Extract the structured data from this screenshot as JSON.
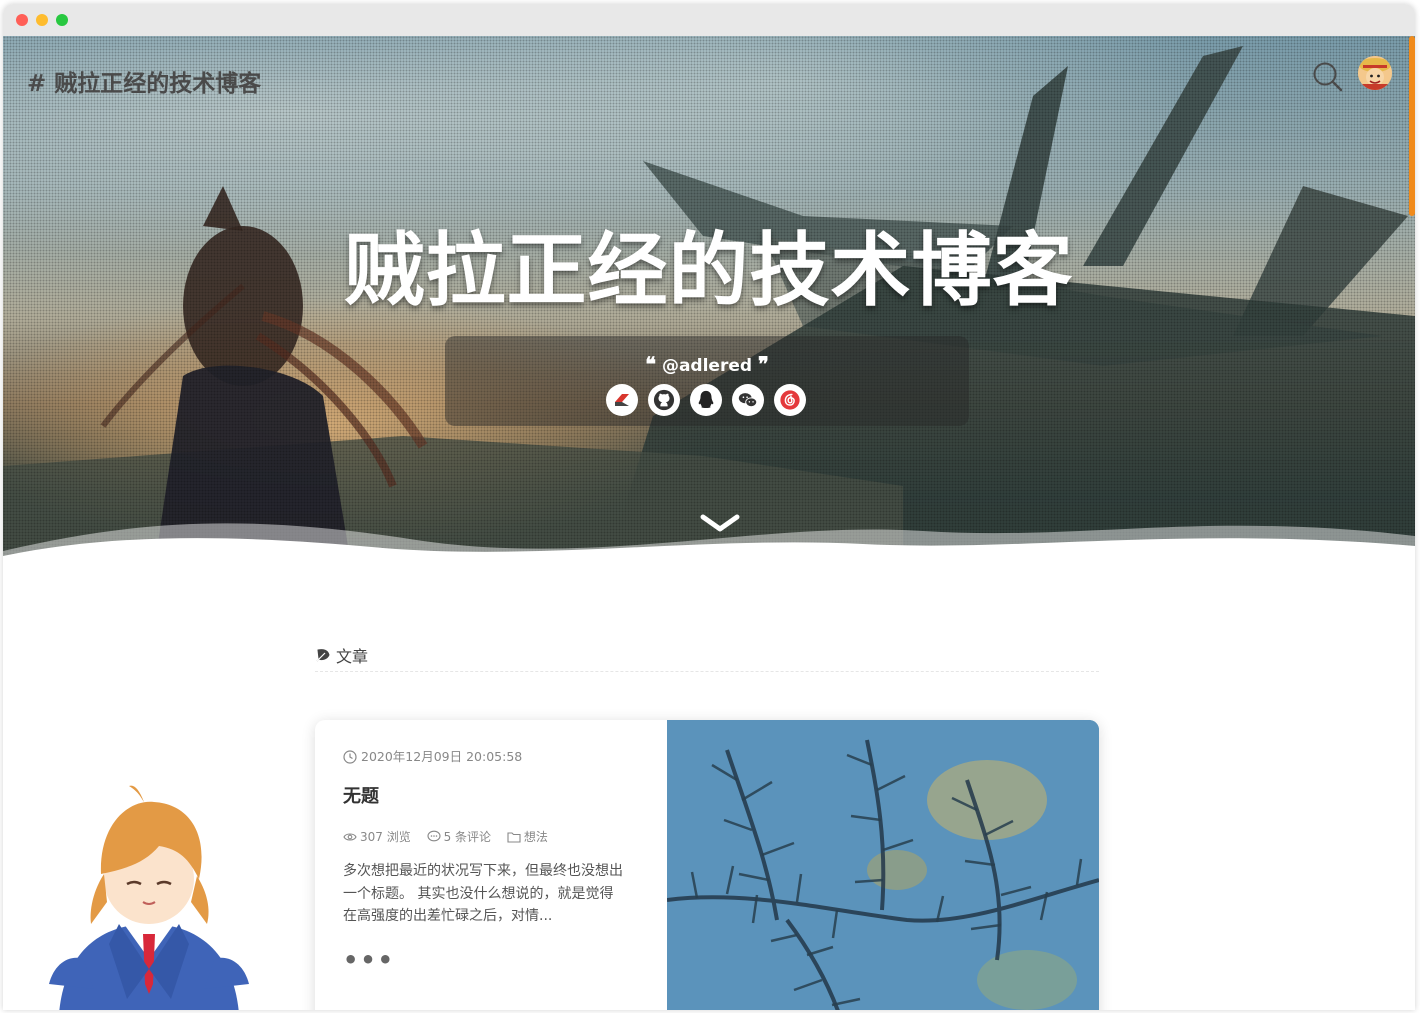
{
  "site": {
    "name": "# 贼拉正经的技术博客"
  },
  "hero": {
    "title": "贼拉正经的技术博客",
    "motto": "@adlered",
    "quote_open": "❝",
    "quote_close": "❞"
  },
  "social_links": [
    {
      "icon": "hacpai-icon",
      "color": "#d8362e"
    },
    {
      "icon": "github-icon",
      "color": "#333333"
    },
    {
      "icon": "qq-icon",
      "color": "#222222"
    },
    {
      "icon": "wechat-icon",
      "color": "#333333"
    },
    {
      "icon": "netease-music-icon",
      "color": "#e4393c"
    }
  ],
  "section": {
    "title": "文章"
  },
  "posts": [
    {
      "date": "2020年12月09日 20:05:58",
      "title": "无题",
      "views": "307 浏览",
      "comments": "5 条评论",
      "category": "想法",
      "excerpt": "多次想把最近的状况写下来，但最终也没想出一个标题。 其实也没什么想说的，就是觉得在高强度的出差忙碌之后，对情...",
      "more": "•••"
    }
  ],
  "colors": {
    "accent": "#f08a1a"
  }
}
